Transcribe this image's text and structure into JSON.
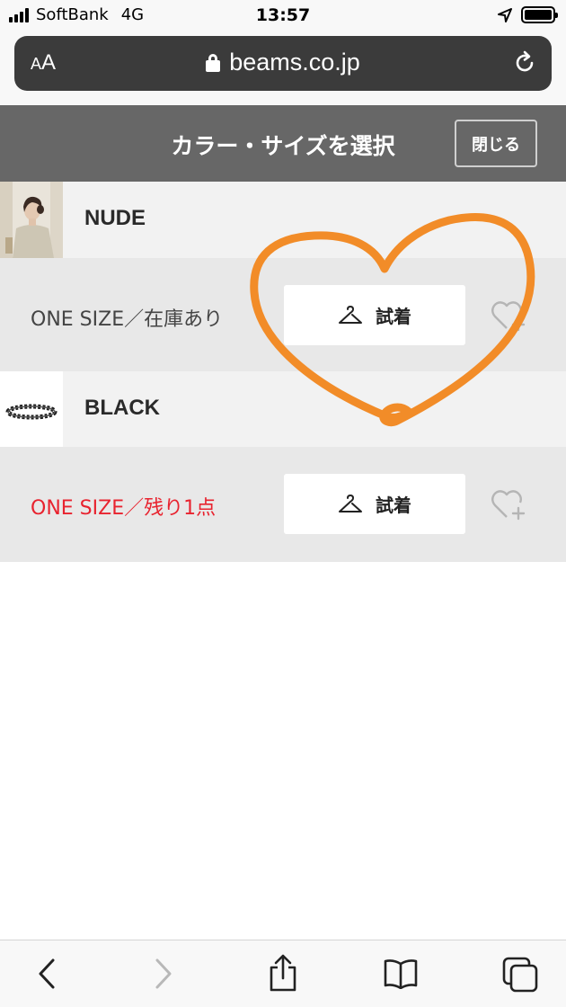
{
  "status_bar": {
    "carrier": "SoftBank",
    "network": "4G",
    "time": "13:57",
    "icons": [
      "signal-icon",
      "location-arrow-icon",
      "battery-icon"
    ]
  },
  "browser": {
    "aa_label": "AA",
    "url": "beams.co.jp",
    "icons": [
      "lock-icon",
      "reload-icon"
    ]
  },
  "modal": {
    "title": "カラー・サイズを選択",
    "close_label": "閉じる"
  },
  "colors": [
    {
      "name": "NUDE",
      "size_label": "ONE SIZE／在庫あり",
      "low_stock": false,
      "try_on_label": "試着"
    },
    {
      "name": "BLACK",
      "size_label": "ONE SIZE／残り1点",
      "low_stock": true,
      "try_on_label": "試着"
    }
  ],
  "toolbar": {
    "icons": [
      "back-icon",
      "forward-icon",
      "share-icon",
      "bookmarks-icon",
      "tabs-icon"
    ]
  },
  "colors_palette": {
    "header_bg": "#676767",
    "low_stock_red": "#e8232f",
    "annotation_orange": "#f28c28",
    "address_bar_bg": "#3b3b3b"
  }
}
